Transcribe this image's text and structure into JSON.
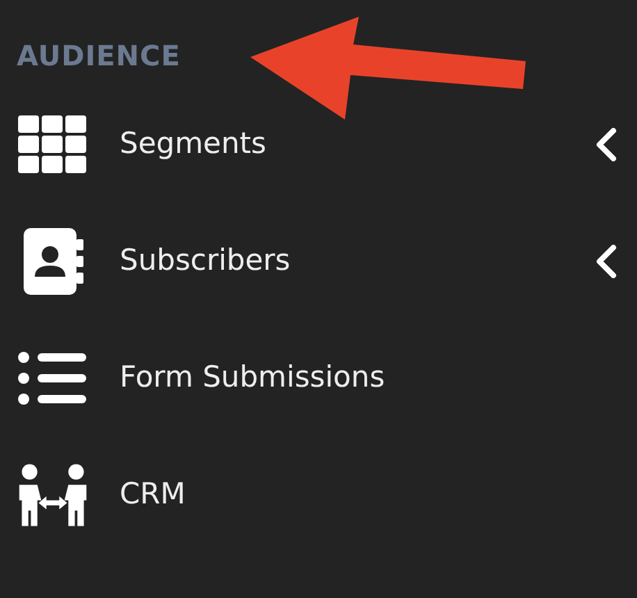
{
  "section": {
    "title": "AUDIENCE"
  },
  "items": [
    {
      "label": "Segments",
      "has_submenu": true
    },
    {
      "label": "Subscribers",
      "has_submenu": true
    },
    {
      "label": "Form Submissions",
      "has_submenu": false
    },
    {
      "label": "CRM",
      "has_submenu": false
    }
  ]
}
